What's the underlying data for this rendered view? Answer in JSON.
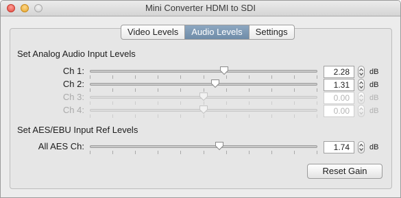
{
  "window": {
    "title": "Mini Converter HDMI to SDI"
  },
  "tabs": [
    {
      "label": "Video Levels",
      "active": false
    },
    {
      "label": "Audio Levels",
      "active": true
    },
    {
      "label": "Settings",
      "active": false
    }
  ],
  "analog": {
    "heading": "Set Analog Audio Input Levels",
    "channels": [
      {
        "label": "Ch 1:",
        "value": "2.28",
        "unit": "dB",
        "enabled": true,
        "level": 0.59
      },
      {
        "label": "Ch 2:",
        "value": "1.31",
        "unit": "dB",
        "enabled": true,
        "level": 0.55
      },
      {
        "label": "Ch 3:",
        "value": "0.00",
        "unit": "dB",
        "enabled": false,
        "level": 0.5
      },
      {
        "label": "Ch 4:",
        "value": "0.00",
        "unit": "dB",
        "enabled": false,
        "level": 0.5
      }
    ]
  },
  "aes": {
    "heading": "Set AES/EBU Input Ref Levels",
    "channel": {
      "label": "All AES Ch:",
      "value": "1.74",
      "unit": "dB",
      "enabled": true,
      "level": 0.57
    }
  },
  "buttons": {
    "reset": "Reset Gain"
  },
  "colors": {
    "active_tab": "#7b97b4",
    "window_bg": "#ececec",
    "close": "#e1483f",
    "minimize": "#e4a52c"
  }
}
